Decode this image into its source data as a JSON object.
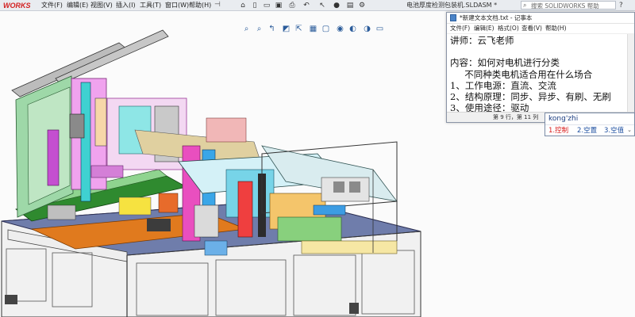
{
  "app": {
    "logo_text": "WORKS",
    "document_title": "电池厚度检测包装机.SLDASM *",
    "search_placeholder": "搜索 SOLIDWORKS 帮助",
    "help_glyph": "?"
  },
  "menu": [
    "文件(F)",
    "编辑(E)",
    "视图(V)",
    "插入(I)",
    "工具(T)",
    "窗口(W)",
    "帮助(H)"
  ],
  "notepad": {
    "title": "*新建文本文档.txt - 记事本",
    "menu": [
      "文件(F)",
      "编辑(E)",
      "格式(O)",
      "查看(V)",
      "帮助(H)"
    ],
    "lines": [
      "讲师：云飞老师",
      "",
      "内容：如何对电机进行分类",
      "     不同种类电机适合用在什么场合",
      "1、工作电源：直流、交流",
      "2、结构原理：同步、异步、有刷、无刷",
      "3、使用途径：驱动"
    ],
    "status": "第 9 行，第 11 列"
  },
  "ime": {
    "pinyin": "kong'zhi",
    "candidates": [
      "1.控制",
      "2.空置",
      "3.空值"
    ]
  },
  "colors": {
    "accent_red": "#d32020",
    "ime_blue": "#1d4fa0"
  }
}
